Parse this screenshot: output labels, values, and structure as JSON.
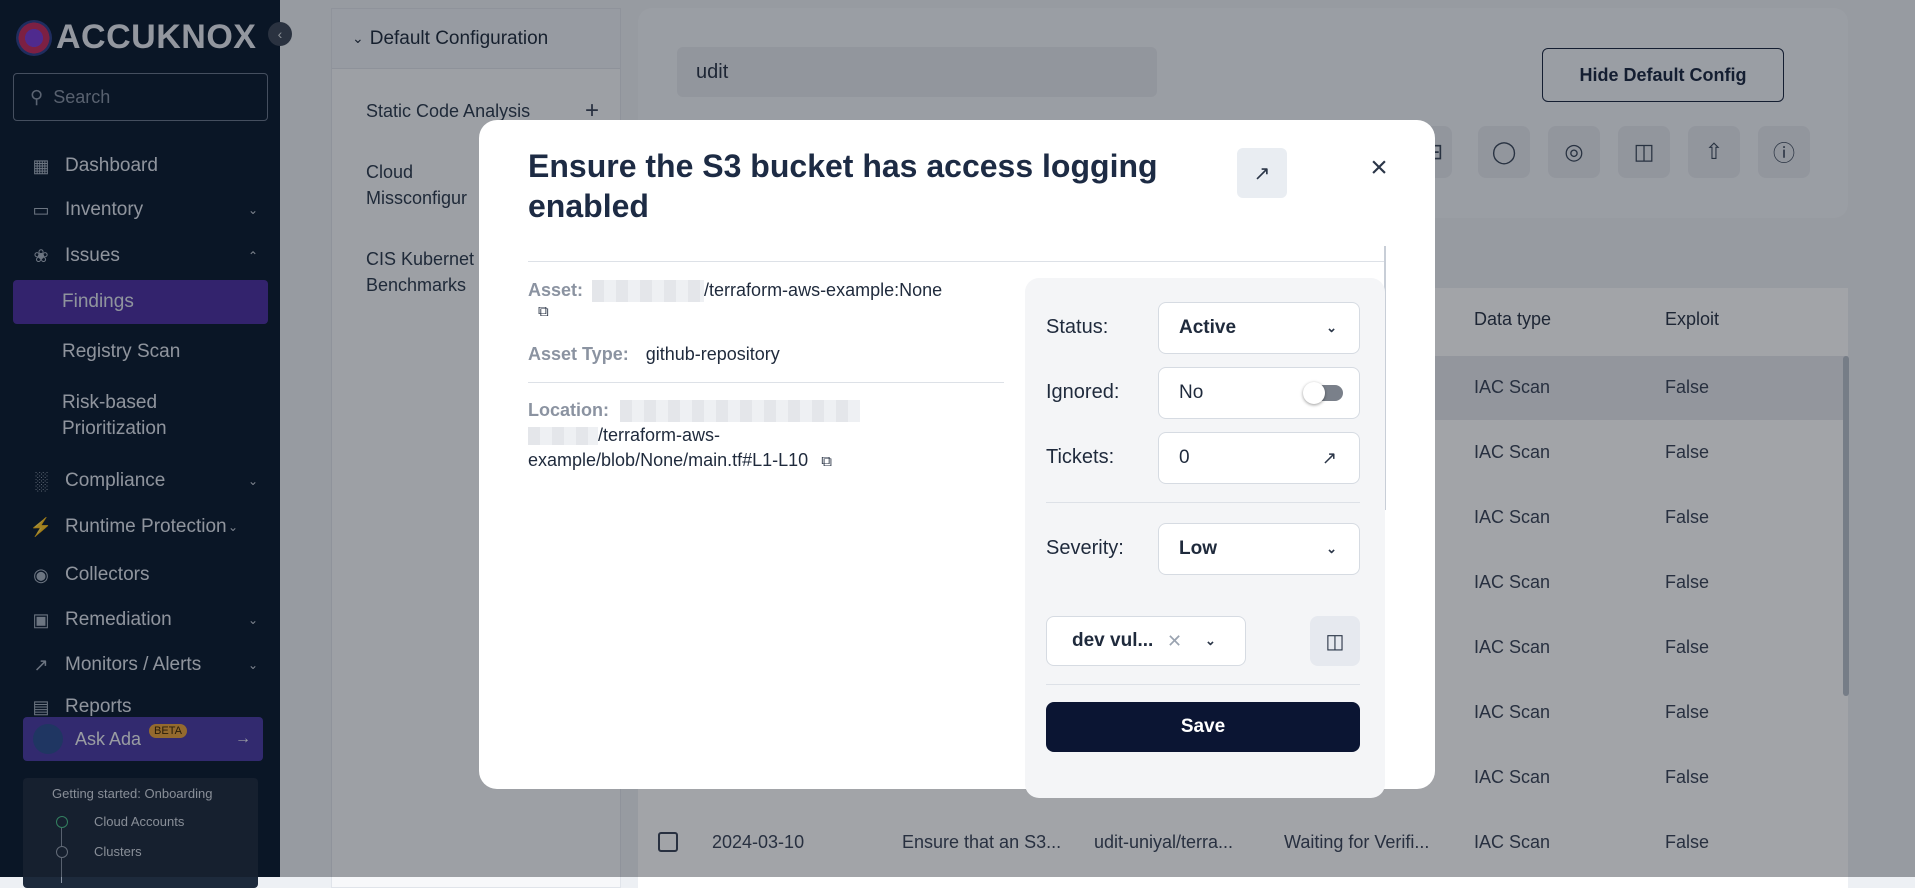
{
  "sidebar": {
    "logo_text": "ACCUKNOX",
    "search_placeholder": "Search",
    "items": [
      {
        "label": "Dashboard"
      },
      {
        "label": "Inventory"
      },
      {
        "label": "Issues"
      },
      {
        "label": "Findings"
      },
      {
        "label": "Registry Scan"
      },
      {
        "label": "Risk-based Prioritization"
      },
      {
        "label": "Compliance"
      },
      {
        "label": "Runtime Protection"
      },
      {
        "label": "Collectors"
      },
      {
        "label": "Remediation"
      },
      {
        "label": "Monitors / Alerts"
      },
      {
        "label": "Reports"
      }
    ],
    "ask_ada": {
      "label": "Ask Ada",
      "badge": "BETA"
    },
    "onboarding": {
      "title": "Getting started: Onboarding",
      "steps": [
        "Cloud Accounts",
        "Clusters"
      ]
    }
  },
  "config_panel": {
    "header": "Default Configuration",
    "items": [
      "Static Code Analysis",
      "Cloud Missconfigur",
      "CIS Kubernet Benchmarks"
    ]
  },
  "main": {
    "search_value": "udit",
    "hide_default_label": "Hide Default Config",
    "table": {
      "headers": [
        "Data type",
        "Exploit"
      ],
      "rows": [
        {
          "data_type": "IAC Scan",
          "exploit": "False"
        },
        {
          "data_type": "IAC Scan",
          "exploit": "False"
        },
        {
          "data_type": "IAC Scan",
          "exploit": "False"
        },
        {
          "data_type": "IAC Scan",
          "exploit": "False"
        },
        {
          "data_type": "IAC Scan",
          "exploit": "False"
        },
        {
          "data_type": "IAC Scan",
          "exploit": "False"
        },
        {
          "data_type": "IAC Scan",
          "exploit": "False"
        }
      ],
      "last_row": {
        "date": "2024-03-10",
        "title": "Ensure that an S3...",
        "asset": "udit-uniyal/terra...",
        "status": "Waiting for Verifi...",
        "data_type": "IAC Scan",
        "exploit": "False"
      }
    }
  },
  "modal": {
    "title": "Ensure the S3 bucket has access logging enabled",
    "asset_label": "Asset:",
    "asset_value": "/terraform-aws-example:None",
    "asset_type_label": "Asset Type:",
    "asset_type_value": "github-repository",
    "location_label": "Location:",
    "location_value_1": "/terraform-aws-",
    "location_value_2": "example/blob/None/main.tf#L1-L10",
    "status_label": "Status:",
    "status_value": "Active",
    "ignored_label": "Ignored:",
    "ignored_value": "No",
    "tickets_label": "Tickets:",
    "tickets_value": "0",
    "severity_label": "Severity:",
    "severity_value": "Low",
    "tag_value": "dev vul...",
    "save_label": "Save"
  }
}
